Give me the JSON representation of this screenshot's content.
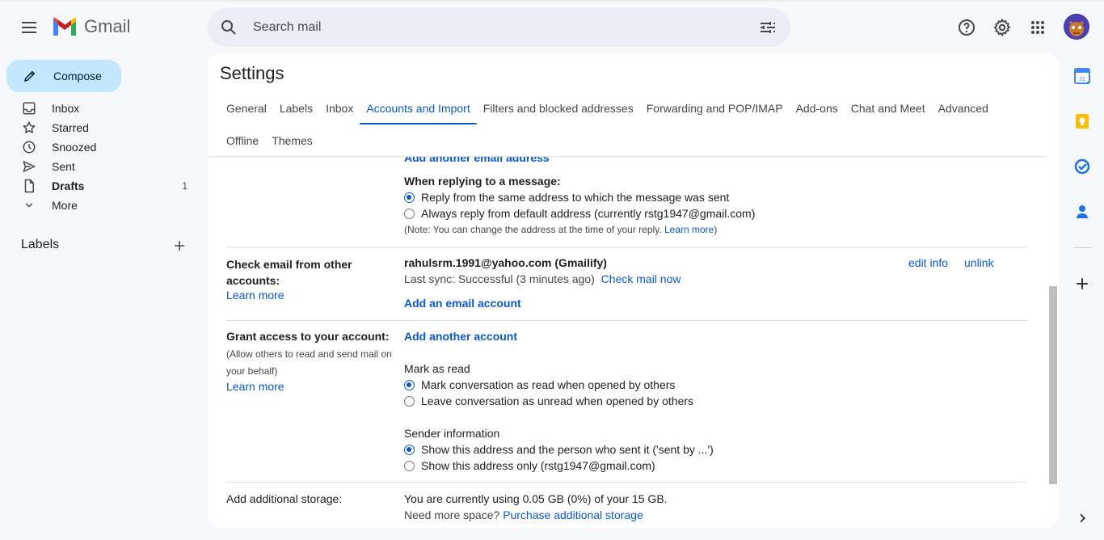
{
  "app": {
    "name": "Gmail"
  },
  "search": {
    "placeholder": "Search mail"
  },
  "compose": {
    "label": "Compose"
  },
  "nav": {
    "items": [
      {
        "label": "Inbox",
        "icon": "inbox-icon",
        "count": ""
      },
      {
        "label": "Starred",
        "icon": "star-icon",
        "count": ""
      },
      {
        "label": "Snoozed",
        "icon": "clock-icon",
        "count": ""
      },
      {
        "label": "Sent",
        "icon": "send-icon",
        "count": ""
      },
      {
        "label": "Drafts",
        "icon": "draft-icon",
        "count": "1"
      },
      {
        "label": "More",
        "icon": "chevron-down-icon",
        "count": ""
      }
    ],
    "labels_title": "Labels"
  },
  "settings": {
    "title": "Settings",
    "tabs_row1": [
      "General",
      "Labels",
      "Inbox",
      "Accounts and Import",
      "Filters and blocked addresses",
      "Forwarding and POP/IMAP",
      "Add-ons",
      "Chat and Meet",
      "Advanced"
    ],
    "tabs_row2": [
      "Offline",
      "Themes"
    ],
    "active_tab": "Accounts and Import"
  },
  "reply": {
    "add_another_email": "Add another email address",
    "heading": "When replying to a message:",
    "option1": "Reply from the same address to which the message was sent",
    "option2": "Always reply from default address (currently rstg1947@gmail.com)",
    "note": "(Note: You can change the address at the time of your reply.",
    "note_link": "Learn more",
    "note_end": ")",
    "selected": 1
  },
  "check_email": {
    "label": "Check email from other accounts:",
    "learn_more": "Learn more",
    "account": "rahulsrm.1991@yahoo.com (Gmailify)",
    "last_sync": "Last sync: Successful (3 minutes ago)",
    "check_now": "Check mail now",
    "add_account": "Add an email account",
    "edit_info": "edit info",
    "unlink": "unlink"
  },
  "grant_access": {
    "label": "Grant access to your account:",
    "sub": "(Allow others to read and send mail on your behalf)",
    "learn_more": "Learn more",
    "add_account": "Add another account",
    "mark_read_heading": "Mark as read",
    "mark_option1": "Mark conversation as read when opened by others",
    "mark_option2": "Leave conversation as unread when opened by others",
    "mark_selected": 1,
    "sender_heading": "Sender information",
    "sender_option1": "Show this address and the person who sent it ('sent by ...')",
    "sender_option2": "Show this address only (rstg1947@gmail.com)",
    "sender_selected": 1
  },
  "storage": {
    "label": "Add additional storage:",
    "usage": "You are currently using 0.05 GB (0%) of your 15 GB.",
    "need_more": "Need more space?",
    "purchase": "Purchase additional storage"
  },
  "colors": {
    "accent": "#0b57d0",
    "compose_bg": "#c2e7ff",
    "search_bg": "#e9eef6",
    "page_bg": "#f6f8fc"
  }
}
